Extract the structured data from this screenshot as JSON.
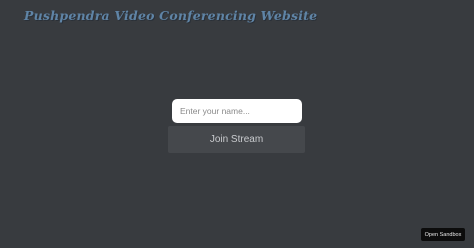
{
  "header": {
    "title": "Pushpendra Video Conferencing Website"
  },
  "join_form": {
    "name_placeholder": "Enter your name...",
    "name_value": "",
    "join_label": "Join Stream"
  },
  "sandbox": {
    "open_label": "Open Sandbox"
  },
  "colors": {
    "background": "#383b3f",
    "title": "#5f84a6",
    "input_background": "#ffffff",
    "button_background": "#45484c",
    "button_text": "#c9cbce",
    "sandbox_background": "#0c0c0c"
  }
}
